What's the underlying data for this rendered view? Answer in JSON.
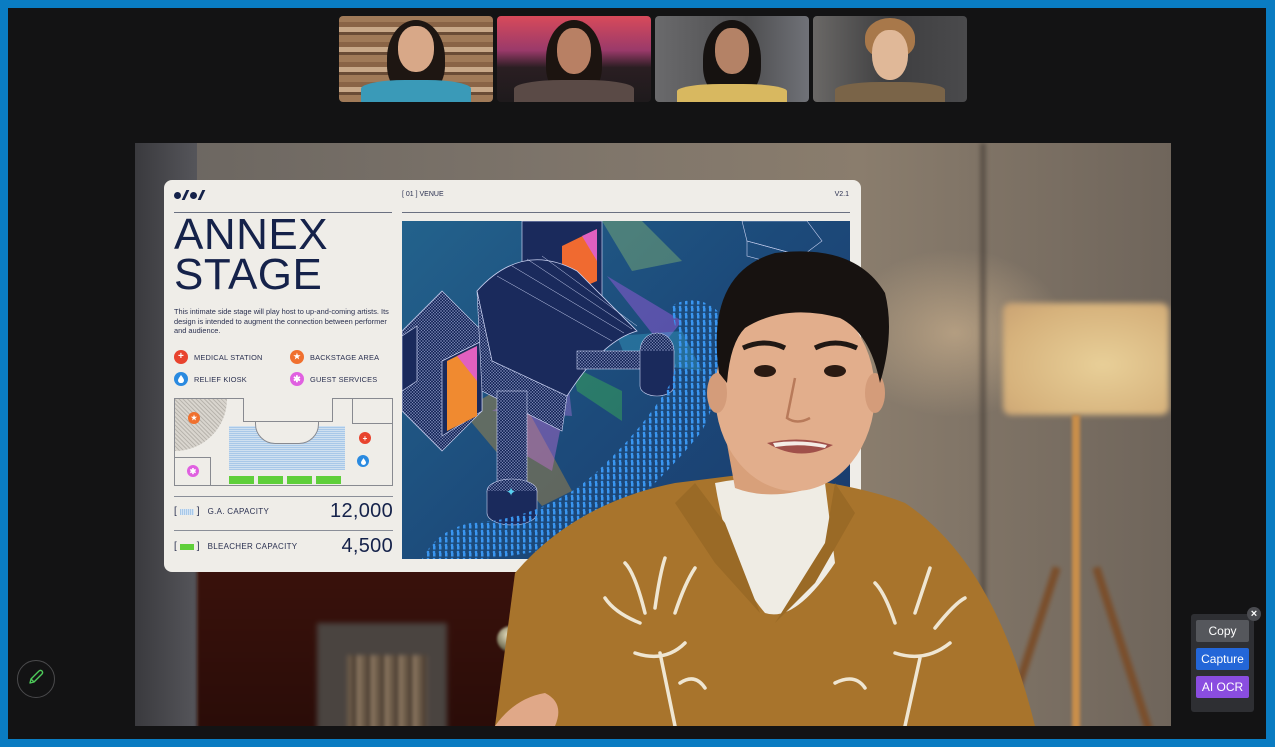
{
  "participants": [
    {
      "name": "participant-1",
      "bg": "#8a6a50",
      "hair": "#1e1612",
      "skin": "#d8a888",
      "clothing": "#3a9ab8"
    },
    {
      "name": "participant-2",
      "bg": "#3a2a2e",
      "hair": "#1c1410",
      "skin": "#b88064",
      "clothing": "#5a4a46"
    },
    {
      "name": "participant-3",
      "bg": "#5e5e60",
      "hair": "#161210",
      "skin": "#b48266",
      "clothing": "#d8b860"
    },
    {
      "name": "participant-4",
      "bg": "#4a4a4c",
      "hair": "#a8784a",
      "skin": "#e0b898",
      "clothing": "#7a6448"
    }
  ],
  "poster": {
    "header_left": "[ 01 ] VENUE",
    "header_right": "V2.1",
    "title_line1": "ANNEX",
    "title_line2": "STAGE",
    "description": "This intimate side stage will play host to up-and-coming artists. Its design is intended to augment the connection between performer and audience.",
    "legend": [
      {
        "label": "MEDICAL STATION",
        "icon": "plus-icon",
        "glyph": "+",
        "color": "#e8432e"
      },
      {
        "label": "BACKSTAGE AREA",
        "icon": "star-icon",
        "glyph": "★",
        "color": "#f0702e"
      },
      {
        "label": "RELIEF KIOSK",
        "icon": "water-drop-icon",
        "glyph": "💧",
        "color": "#2a8ae0"
      },
      {
        "label": "GUEST SERVICES",
        "icon": "asterisk-icon",
        "glyph": "✱",
        "color": "#e060e0"
      }
    ],
    "capacities": [
      {
        "label": "G.A. CAPACITY",
        "value": "12,000",
        "swatch": "#a8c8e8"
      },
      {
        "label": "BLEACHER CAPACITY",
        "value": "4,500",
        "swatch": "#5fcf3a"
      }
    ]
  },
  "controls": {
    "annotate_icon": "pencil-icon",
    "ocr_panel": {
      "copy_label": "Copy",
      "capture_label": "Capture",
      "ai_ocr_label": "AI OCR",
      "close_glyph": "×"
    }
  },
  "colors": {
    "frame_border": "#0a7cc2",
    "background": "#131314",
    "copy_button": "#55575c",
    "capture_button": "#2366d8",
    "ai_ocr_button": "#8a4de0",
    "pencil_accent": "#4ecb5a"
  }
}
